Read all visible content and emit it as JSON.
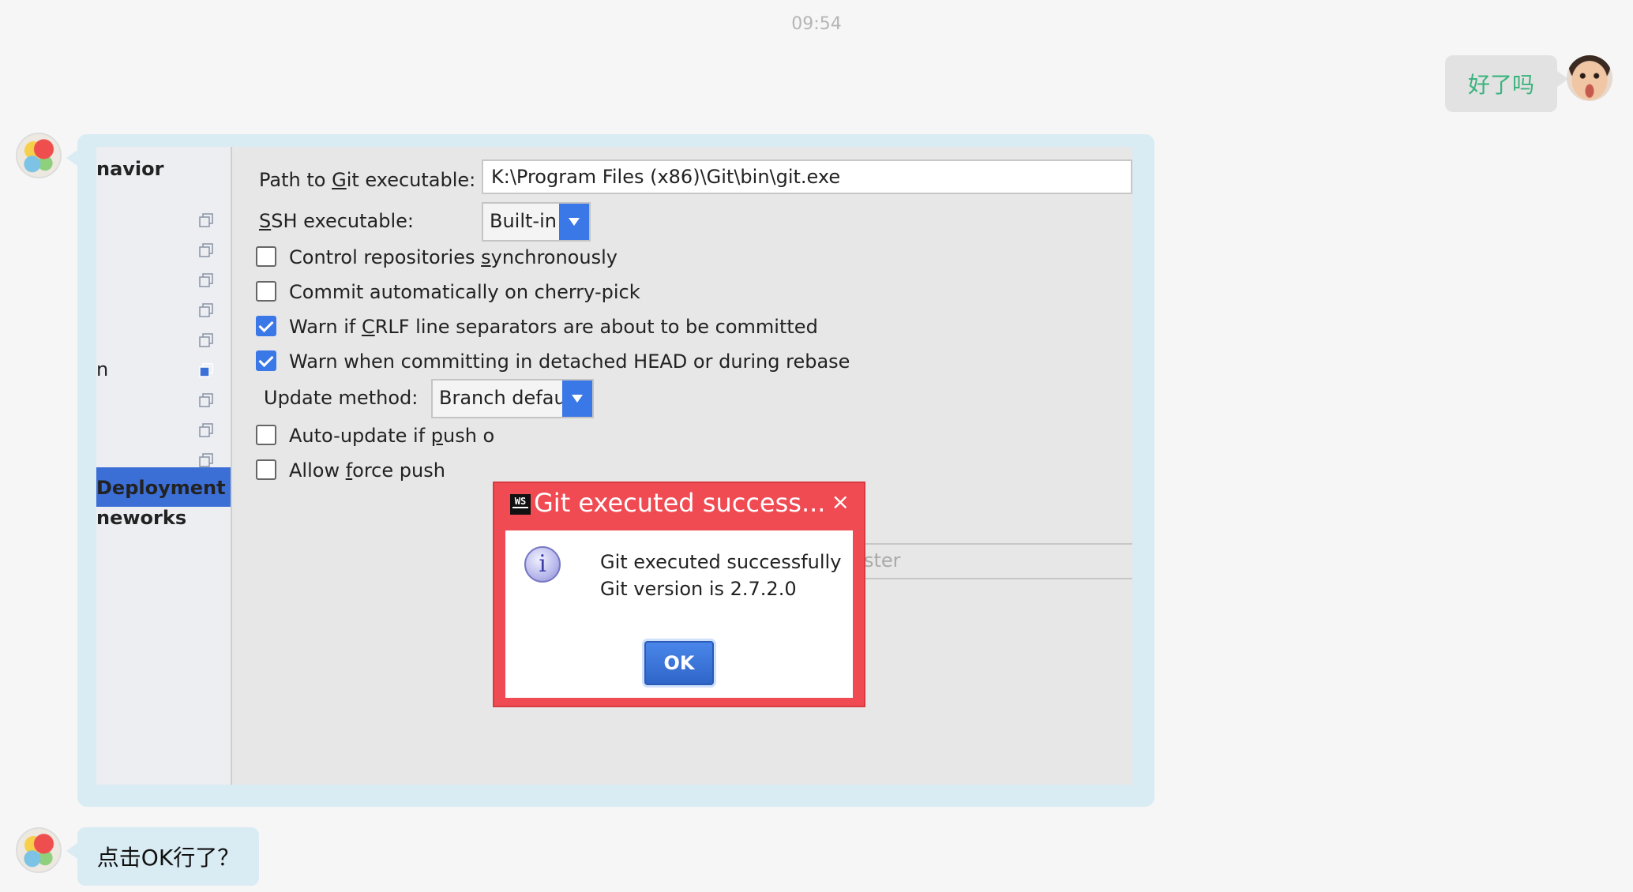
{
  "chat": {
    "timestamp": "09:54",
    "user_message": "好了吗",
    "bot_message": "点击OK行了？"
  },
  "settings": {
    "sidebar": {
      "items": [
        "navior",
        "n",
        "Deployment",
        "neworks"
      ]
    },
    "path_label_pre": "Path to ",
    "path_label_u": "G",
    "path_label_post": "it executable:",
    "path_value": "K:\\Program Files (x86)\\Git\\bin\\git.exe",
    "ssh_label_u": "S",
    "ssh_label_post": "SH executable:",
    "ssh_value": "Built-in",
    "checkboxes": [
      {
        "pre": "Control repositories ",
        "u": "s",
        "post": "ynchronously",
        "checked": false
      },
      {
        "pre": "Commit automatically on cherry-pick",
        "u": "",
        "post": "",
        "checked": false
      },
      {
        "pre": "Warn if ",
        "u": "C",
        "post": "RLF line separators are about to be committed",
        "checked": true
      },
      {
        "pre": "Warn when committing in detached HEAD or during rebase",
        "u": "",
        "post": "",
        "checked": true
      },
      {
        "pre": "Auto-update if ",
        "u": "p",
        "post": "ush o",
        "checked": false
      },
      {
        "pre": "Allow ",
        "u": "f",
        "post": "orce push",
        "checked": false
      }
    ],
    "update_label": "Update method:",
    "update_value": "Branch default",
    "protected_hint": "ster"
  },
  "dialog": {
    "title": "Git executed success...",
    "app_badge": "WS",
    "close_glyph": "×",
    "info_glyph": "i",
    "line1": "Git executed successfully",
    "line2": "Git version is 2.7.2.0",
    "ok_label": "OK"
  },
  "colors": {
    "accent": "#3b78e7",
    "dialog_highlight": "#f04a52",
    "chat_bubble": "#d9ebf3",
    "user_text": "#3bb37d"
  },
  "icons": [
    "copy-icon",
    "info-icon",
    "close-icon",
    "dropdown-arrow-icon",
    "webstorm-icon"
  ]
}
